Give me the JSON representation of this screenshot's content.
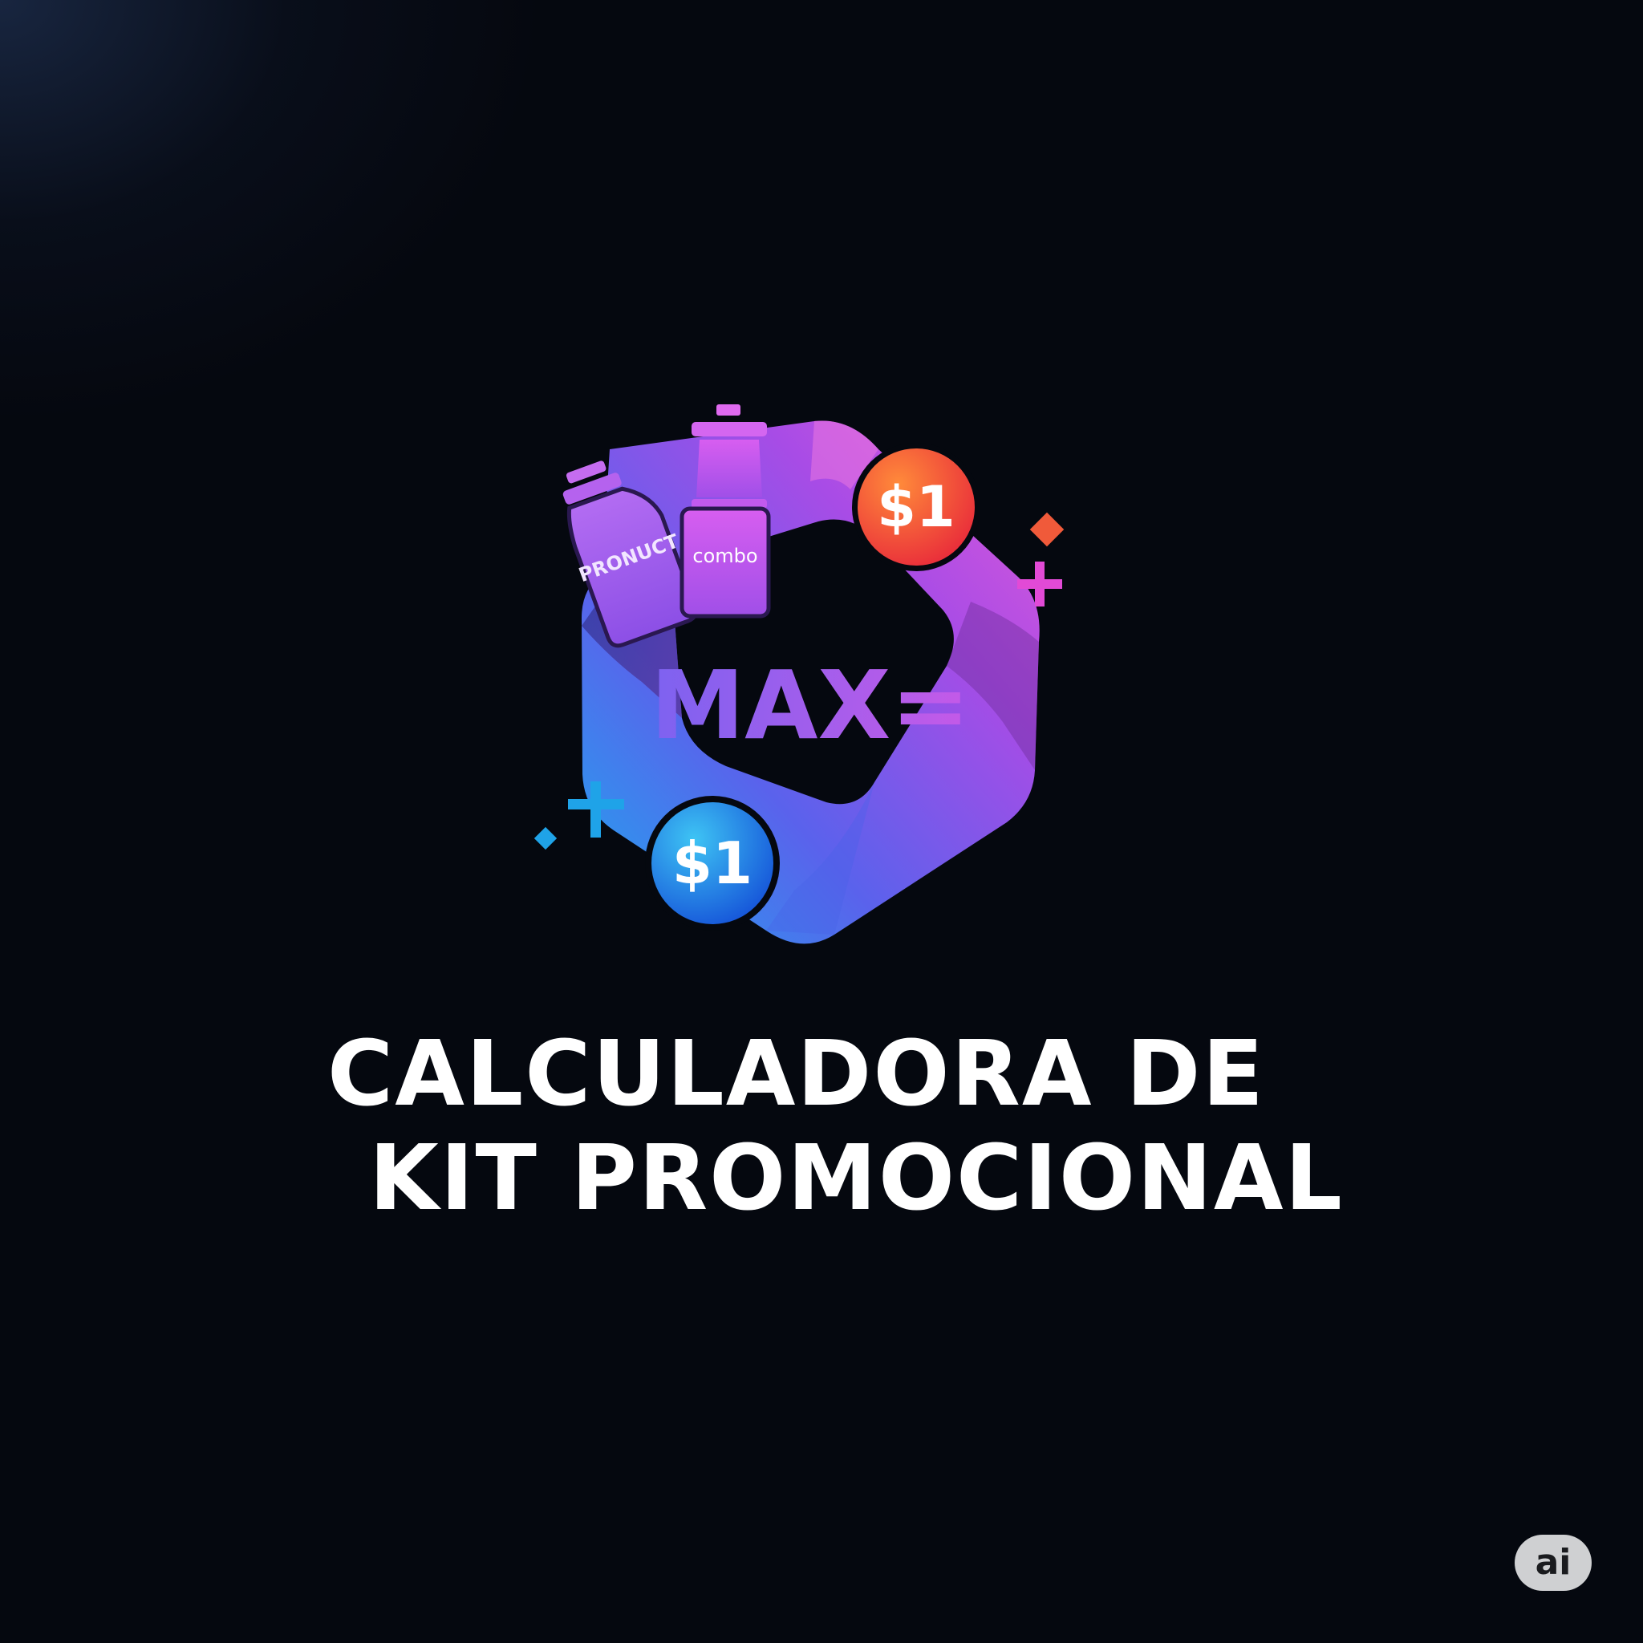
{
  "title": {
    "line1": "CALCULADORA DE",
    "line2": "KIT PROMOCIONAL"
  },
  "logo": {
    "bottle_label": "PRONUCT",
    "jar_label": "combo",
    "wordmark": "MAX=",
    "coin_top_label": "$1",
    "coin_bottom_label": "$1"
  },
  "badge": {
    "label": "ai"
  },
  "colors": {
    "background": "#05080f",
    "ribbon_purple": "#b84be8",
    "ribbon_blue": "#4a7cf0",
    "coin_top": "#f0442f",
    "coin_bottom": "#1e6fe6",
    "accent_cyan": "#1fa3e8",
    "accent_pink": "#e24ad6",
    "accent_orange": "#f05a3a"
  }
}
